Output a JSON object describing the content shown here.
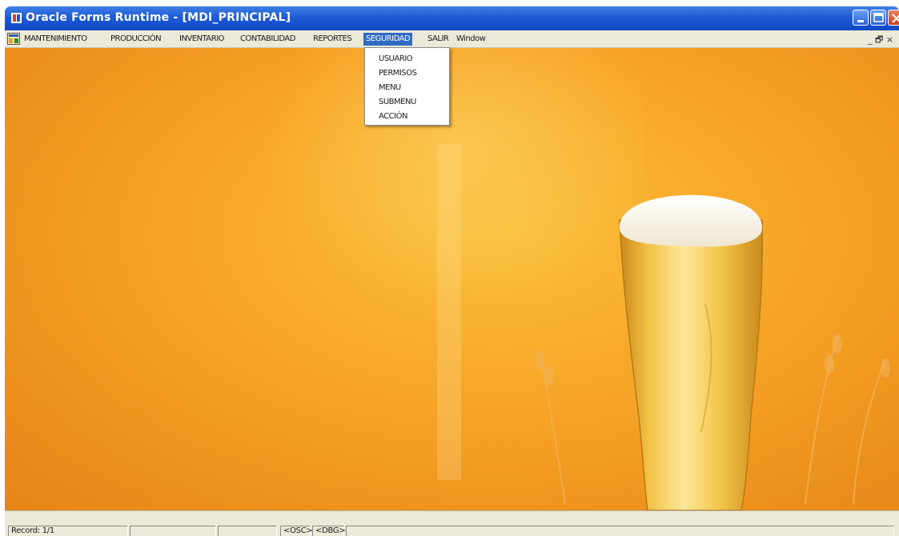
{
  "window": {
    "title": "Oracle Forms Runtime - [MDI_PRINCIPAL]"
  },
  "menu": {
    "items": [
      {
        "label": "MANTENIMIENTO"
      },
      {
        "label": "PRODUCCIÓN"
      },
      {
        "label": "INVENTARIO"
      },
      {
        "label": "CONTABILIDAD"
      },
      {
        "label": "REPORTES"
      },
      {
        "label": "SEGURIDAD",
        "active": true
      },
      {
        "label": "SALIR"
      },
      {
        "label": "Window"
      }
    ],
    "mdi_controls": "_ 🗗 ×"
  },
  "dropdown": {
    "parent": "SEGURIDAD",
    "items": [
      {
        "label": "USUARIO"
      },
      {
        "label": "PERMISOS"
      },
      {
        "label": "MENU"
      },
      {
        "label": "SUBMENU"
      },
      {
        "label": "ACCIÓN"
      }
    ]
  },
  "status": {
    "record": "Record: 1/1",
    "osc": "<OSC>",
    "dbg": "<DBG>"
  },
  "colors": {
    "titlebar": "#1d5bd6",
    "menubar": "#ece9d8",
    "menu_highlight": "#316ac5",
    "background_orange": "#f6a426"
  },
  "icons": {
    "app": "oracle-forms-icon",
    "document": "document-icon",
    "minimize": "minimize-icon",
    "maximize": "maximize-icon",
    "close": "close-icon"
  }
}
